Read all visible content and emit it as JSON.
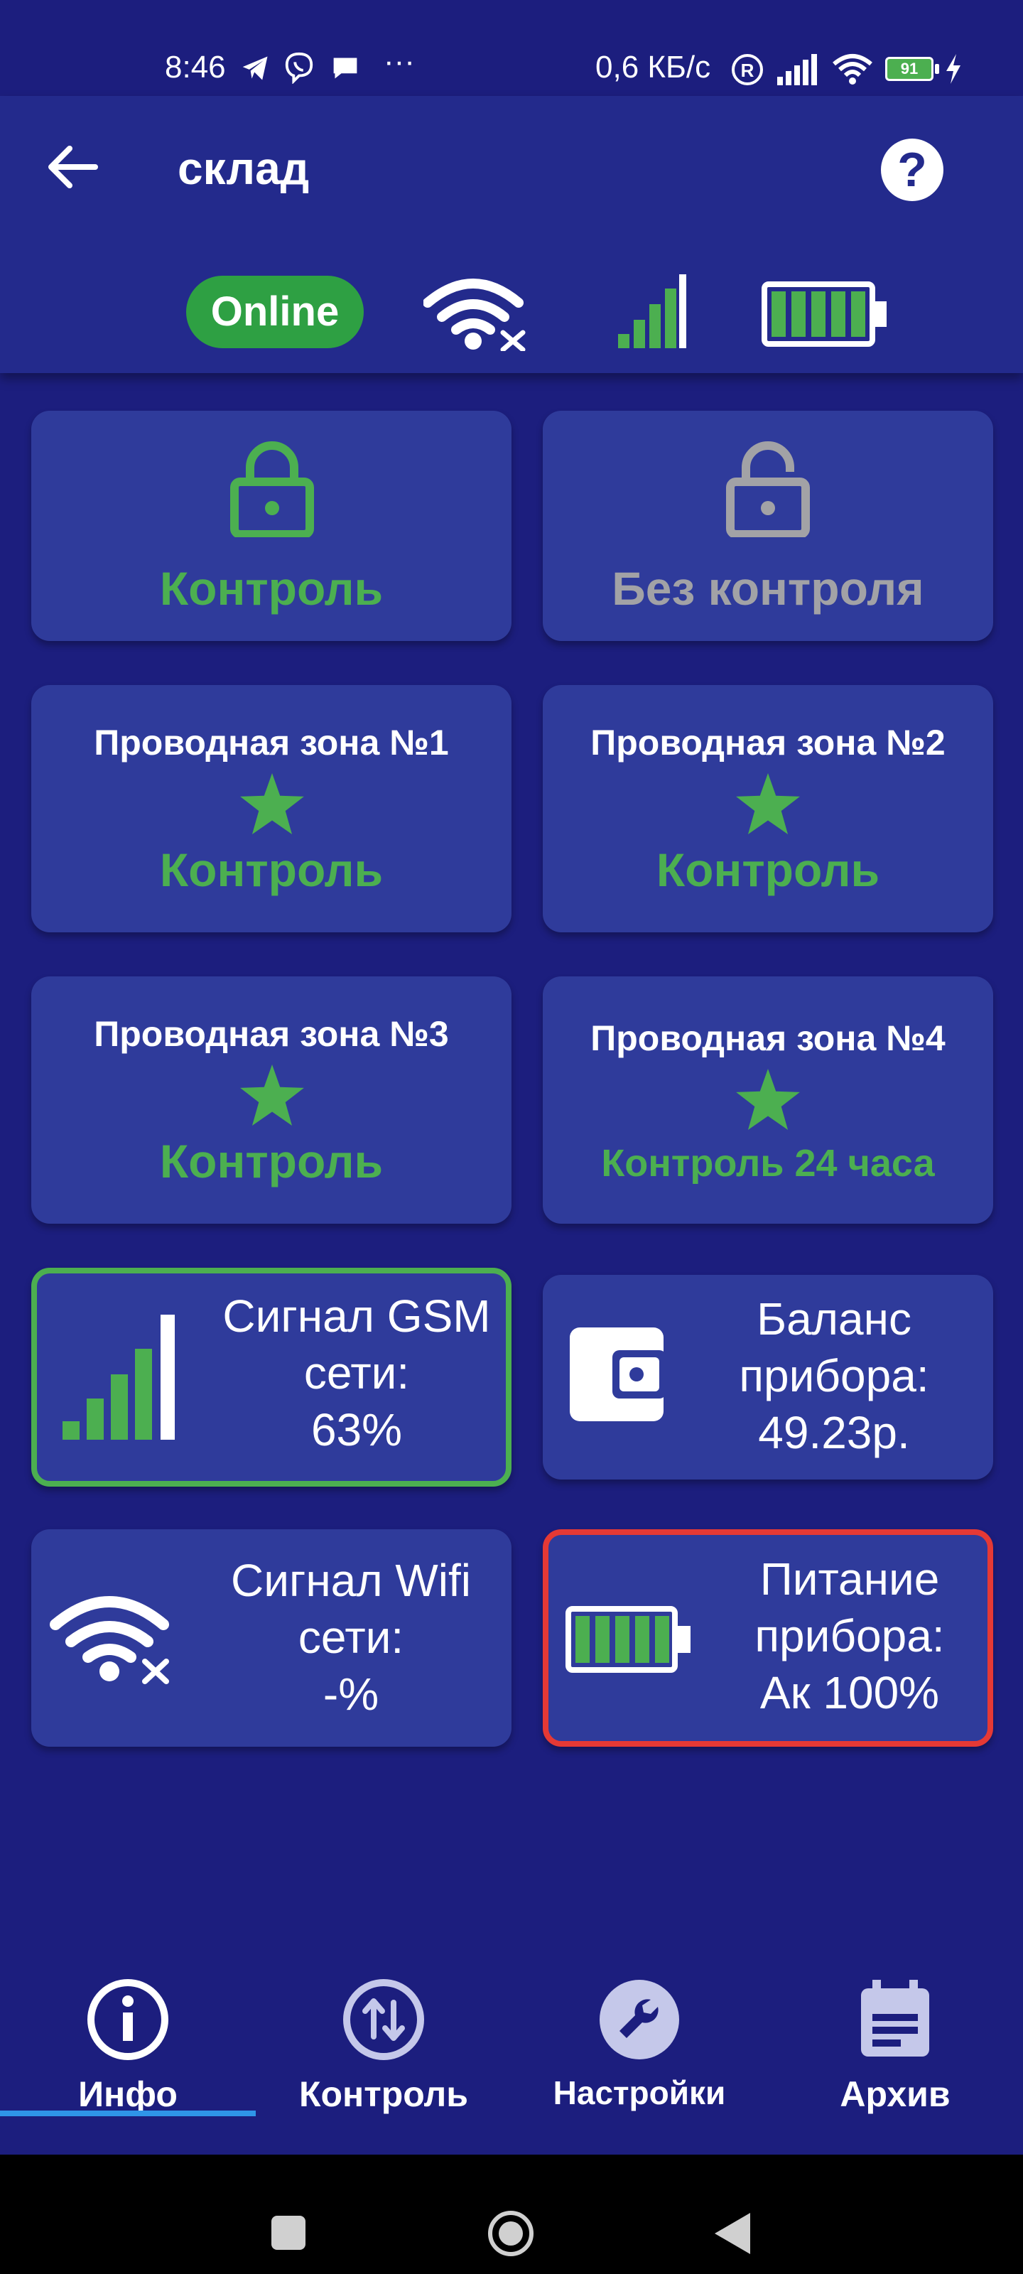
{
  "status_bar": {
    "time": "8:46",
    "net_speed": "0,6 КБ/с",
    "battery_level": "91"
  },
  "app_bar": {
    "title": "склад",
    "online_label": "Online",
    "help_label": "?"
  },
  "mode_cards": [
    {
      "label": "Контроль",
      "state": "active"
    },
    {
      "label": "Без контроля",
      "state": "inactive"
    }
  ],
  "zones": [
    {
      "title": "Проводная зона №1",
      "status": "Контроль"
    },
    {
      "title": "Проводная зона №2",
      "status": "Контроль"
    },
    {
      "title": "Проводная зона №3",
      "status": "Контроль"
    },
    {
      "title": "Проводная зона №4",
      "status": "Контроль 24 часа"
    }
  ],
  "info": {
    "gsm": {
      "line1": "Сигнал GSM",
      "line2": "сети:",
      "value": "63%"
    },
    "balance": {
      "line1": "Баланс",
      "line2": "прибора:",
      "value": "49.23р."
    },
    "wifi": {
      "line1": "Сигнал Wifi",
      "line2": "сети:",
      "value": "-%"
    },
    "power": {
      "line1": "Питание",
      "line2": "прибора:",
      "value": "Ак 100%"
    }
  },
  "bottom_nav": [
    {
      "label": "Инфо",
      "active": true,
      "icon": "info-icon"
    },
    {
      "label": "Контроль",
      "active": false,
      "icon": "swap-vertical-icon"
    },
    {
      "label": "Настройки",
      "active": false,
      "icon": "wrench-icon"
    },
    {
      "label": "Архив",
      "active": false,
      "icon": "calendar-icon"
    }
  ],
  "colors": {
    "background": "#1c1e7e",
    "card": "#2f3b9b",
    "accent_green": "#4caf50",
    "alert_red": "#e53935",
    "inactive_gray": "#a2a2a6",
    "nav_indicator": "#2f95e8"
  }
}
